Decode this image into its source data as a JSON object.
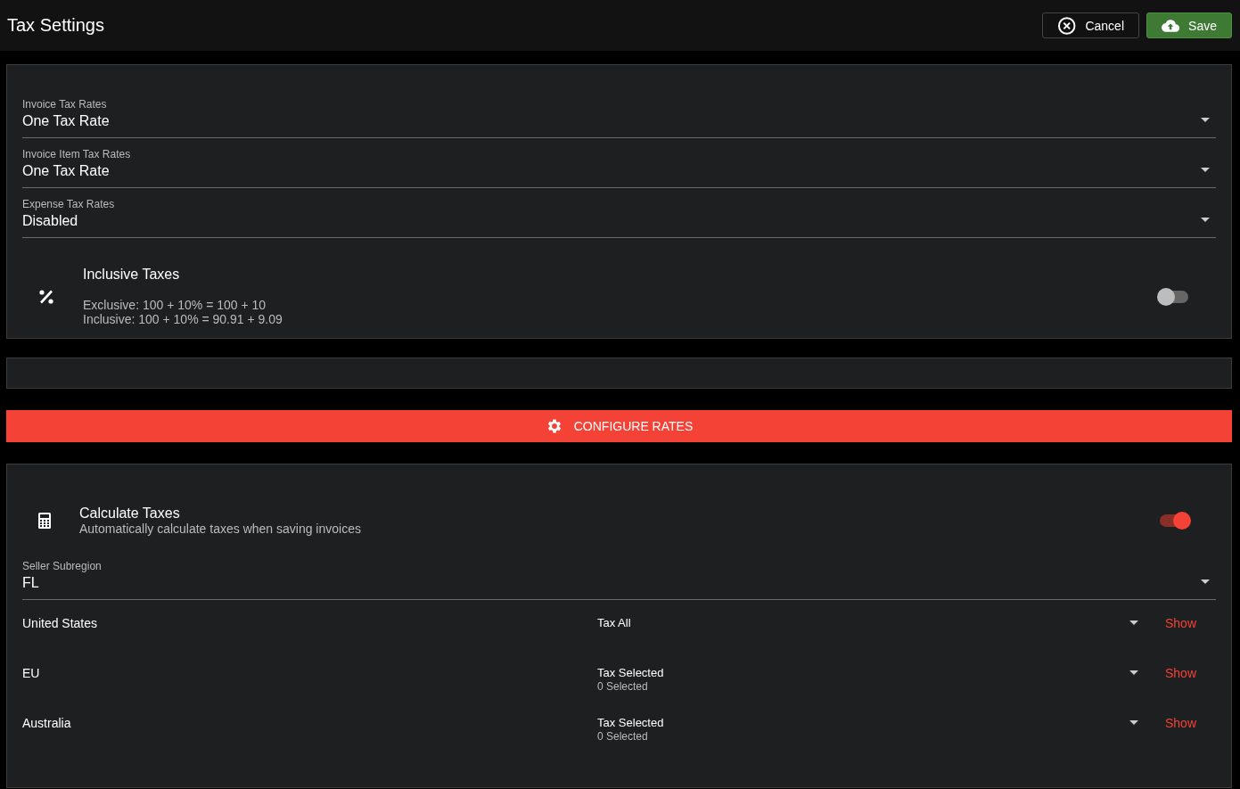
{
  "header": {
    "title": "Tax Settings",
    "cancel": "Cancel",
    "save": "Save"
  },
  "rate_selects": [
    {
      "label": "Invoice Tax Rates",
      "value": "One Tax Rate"
    },
    {
      "label": "Invoice Item Tax Rates",
      "value": "One Tax Rate"
    },
    {
      "label": "Expense Tax Rates",
      "value": "Disabled"
    }
  ],
  "inclusive": {
    "title": "Inclusive Taxes",
    "lines": [
      "Exclusive: 100 + 10% = 100 + 10",
      "Inclusive: 100 + 10% = 90.91 + 9.09"
    ],
    "on": false
  },
  "configure_button": "CONFIGURE RATES",
  "calculate": {
    "title": "Calculate Taxes",
    "subtitle": "Automatically calculate taxes when saving invoices",
    "on": true
  },
  "seller_subregion": {
    "label": "Seller Subregion",
    "value": "FL"
  },
  "regions": [
    {
      "name": "United States",
      "value": "Tax All",
      "link": "Show"
    },
    {
      "name": "EU",
      "value": "Tax Selected",
      "detail": "0 Selected",
      "link": "Show"
    },
    {
      "name": "Australia",
      "value": "Tax Selected",
      "detail": "0 Selected",
      "link": "Show"
    }
  ]
}
